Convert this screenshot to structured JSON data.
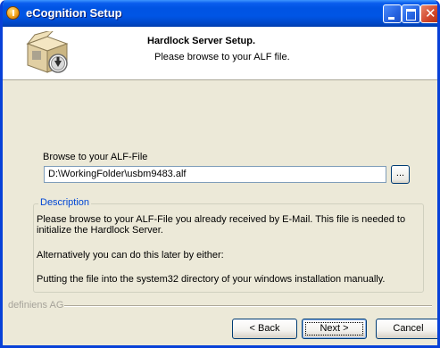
{
  "window": {
    "title": "eCognition Setup"
  },
  "header": {
    "heading": "Hardlock Server Setup.",
    "subtitle": "Please browse to your ALF file.",
    "icon": "setup-box-icon"
  },
  "browse": {
    "label": "Browse to your ALF-File",
    "path_value": "D:\\WorkingFolder\\usbm9483.alf",
    "button_label": "..."
  },
  "description": {
    "legend": "Description",
    "line1": "Please browse to your ALF-File you already received by E-Mail. This file is needed to",
    "line2": "initialize the Hardlock Server.",
    "line3": "Alternatively you can do this later by either:",
    "line4": "Putting the file into the system32 directory of your windows installation manually."
  },
  "footer": {
    "brand": "definiens AG",
    "back_label": "< Back",
    "next_label": "Next >",
    "cancel_label": "Cancel"
  },
  "colors": {
    "titlebar": "#0054e3",
    "dialog_bg": "#ece9d8",
    "legend_text": "#0046d5"
  }
}
